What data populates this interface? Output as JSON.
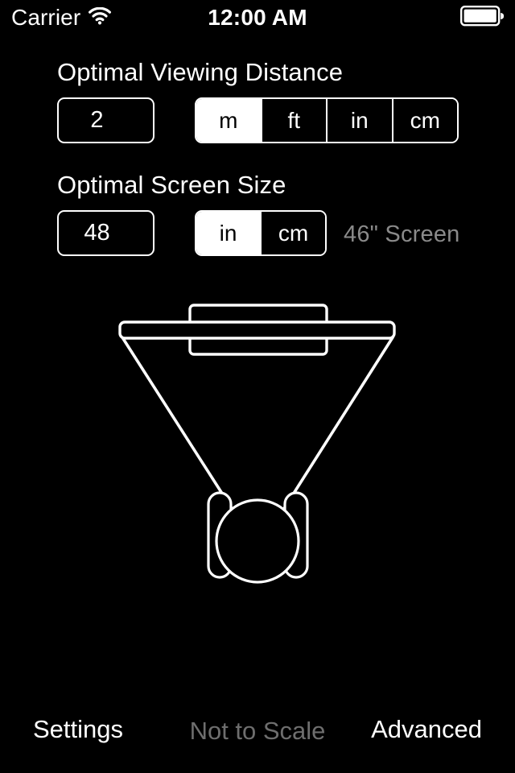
{
  "status_bar": {
    "carrier": "Carrier",
    "wifi_icon": "wifi-icon",
    "time": "12:00 AM",
    "battery_icon": "battery-full-icon"
  },
  "distance_section": {
    "heading": "Optimal Viewing Distance",
    "value": "2",
    "placeholder": "2",
    "units": [
      {
        "label": "m",
        "selected": true
      },
      {
        "label": "ft",
        "selected": false
      },
      {
        "label": "in",
        "selected": false
      },
      {
        "label": "cm",
        "selected": false
      }
    ]
  },
  "screen_section": {
    "heading": "Optimal Screen Size",
    "value": "48",
    "placeholder": "48",
    "units": [
      {
        "label": "in",
        "selected": true
      },
      {
        "label": "cm",
        "selected": false
      }
    ],
    "recommendation": "46\" Screen"
  },
  "diagram": {
    "name": "viewing-angle-diagram",
    "stroke_color": "#ffffff",
    "background_color": "#000000",
    "elements": [
      "tv-screen-rect",
      "tv-stand-bar",
      "viewing-angle-line-left",
      "viewing-angle-line-right",
      "viewer-head",
      "viewer-shoulder-left",
      "viewer-shoulder-right"
    ]
  },
  "toolbar": {
    "settings_label": "Settings",
    "status_label": "Not to Scale",
    "advanced_label": "Advanced",
    "status_color": "#6e6e6e"
  },
  "theme": {
    "background": "#000000",
    "foreground": "#ffffff",
    "muted": "#8a8a8a"
  }
}
